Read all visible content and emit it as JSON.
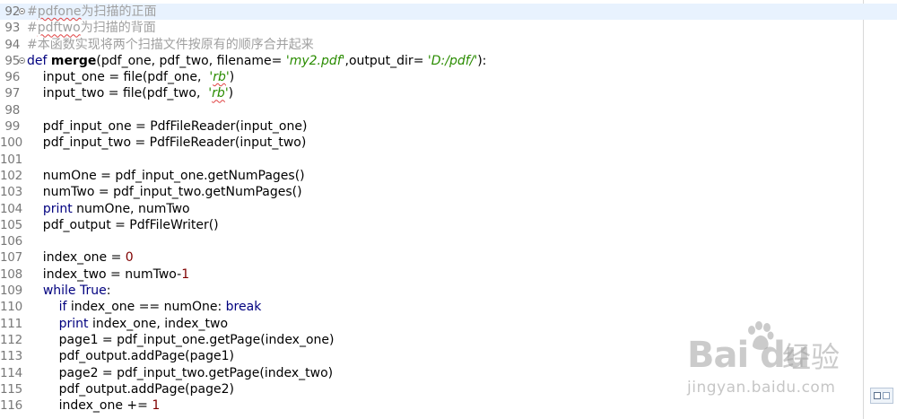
{
  "editor": {
    "lines": [
      {
        "n": "92",
        "current": true,
        "fold": true,
        "tokens": [
          {
            "t": "#",
            "c": "comment"
          },
          {
            "t": "pdfone",
            "c": "comment squig"
          },
          {
            "t": "为扫描的正面",
            "c": "comment"
          }
        ]
      },
      {
        "n": "93",
        "tokens": [
          {
            "t": "#",
            "c": "comment"
          },
          {
            "t": "pdftwo",
            "c": "comment squig"
          },
          {
            "t": "为扫描的背面",
            "c": "comment"
          }
        ]
      },
      {
        "n": "94",
        "tokens": [
          {
            "t": "#本函数实现将两个扫描文件按原有的顺序合并起来",
            "c": "comment"
          }
        ]
      },
      {
        "n": "95",
        "fold": true,
        "tokens": [
          {
            "t": "def ",
            "c": "kw"
          },
          {
            "t": "merge",
            "c": "fn"
          },
          {
            "t": "(pdf_one, pdf_two, filename= "
          },
          {
            "t": "'my2.pdf'",
            "c": "str"
          },
          {
            "t": ",output_dir= "
          },
          {
            "t": "'D:/pdf/'",
            "c": "str"
          },
          {
            "t": "):"
          }
        ]
      },
      {
        "n": "96",
        "tokens": [
          {
            "t": "    input_one = file(pdf_one,  "
          },
          {
            "t": "'",
            "c": "str"
          },
          {
            "t": "rb",
            "c": "str squig"
          },
          {
            "t": "'",
            "c": "str"
          },
          {
            "t": ")"
          }
        ]
      },
      {
        "n": "97",
        "tokens": [
          {
            "t": "    input_two = file(pdf_two,  "
          },
          {
            "t": "'",
            "c": "str"
          },
          {
            "t": "rb",
            "c": "str squig"
          },
          {
            "t": "'",
            "c": "str"
          },
          {
            "t": ")"
          }
        ]
      },
      {
        "n": "98",
        "tokens": []
      },
      {
        "n": "99",
        "tokens": [
          {
            "t": "    pdf_input_one = PdfFileReader(input_one)"
          }
        ]
      },
      {
        "n": "100",
        "tokens": [
          {
            "t": "    pdf_input_two = PdfFileReader(input_two)"
          }
        ]
      },
      {
        "n": "101",
        "tokens": []
      },
      {
        "n": "102",
        "tokens": [
          {
            "t": "    numOne = pdf_input_one.getNumPages()"
          }
        ]
      },
      {
        "n": "103",
        "tokens": [
          {
            "t": "    numTwo = pdf_input_two.getNumPages()"
          }
        ]
      },
      {
        "n": "104",
        "tokens": [
          {
            "t": "    "
          },
          {
            "t": "print",
            "c": "kw"
          },
          {
            "t": " numOne, numTwo"
          }
        ]
      },
      {
        "n": "105",
        "tokens": [
          {
            "t": "    pdf_output = PdfFileWriter()"
          }
        ]
      },
      {
        "n": "106",
        "tokens": []
      },
      {
        "n": "107",
        "tokens": [
          {
            "t": "    index_one = "
          },
          {
            "t": "0",
            "c": "num"
          }
        ]
      },
      {
        "n": "108",
        "tokens": [
          {
            "t": "    index_two = numTwo-"
          },
          {
            "t": "1",
            "c": "num"
          }
        ]
      },
      {
        "n": "109",
        "tokens": [
          {
            "t": "    "
          },
          {
            "t": "while",
            "c": "kw"
          },
          {
            "t": " "
          },
          {
            "t": "True",
            "c": "kw"
          },
          {
            "t": ":"
          }
        ]
      },
      {
        "n": "110",
        "tokens": [
          {
            "t": "        "
          },
          {
            "t": "if",
            "c": "kw"
          },
          {
            "t": " index_one == numOne: "
          },
          {
            "t": "break",
            "c": "kw"
          }
        ]
      },
      {
        "n": "111",
        "tokens": [
          {
            "t": "        "
          },
          {
            "t": "print",
            "c": "kw"
          },
          {
            "t": " index_one, index_two"
          }
        ]
      },
      {
        "n": "112",
        "tokens": [
          {
            "t": "        page1 = pdf_input_one.getPage(index_one)"
          }
        ]
      },
      {
        "n": "113",
        "tokens": [
          {
            "t": "        pdf_output.addPage(page1)"
          }
        ]
      },
      {
        "n": "114",
        "tokens": [
          {
            "t": "        page2 = pdf_input_two.getPage(index_two)"
          }
        ]
      },
      {
        "n": "115",
        "tokens": [
          {
            "t": "        pdf_output.addPage(page2)"
          }
        ]
      },
      {
        "n": "116",
        "tokens": [
          {
            "t": "        index_one += "
          },
          {
            "t": "1",
            "c": "num"
          }
        ]
      }
    ]
  },
  "watermark": {
    "brand": "Bai du",
    "cn": "经验",
    "url": "jingyan.baidu.com"
  },
  "colors": {
    "comment": "#a0a0a0",
    "keyword": "#00007f",
    "string": "#2a8c00",
    "number": "#7f0000",
    "current_line": "#e8f2fe"
  }
}
